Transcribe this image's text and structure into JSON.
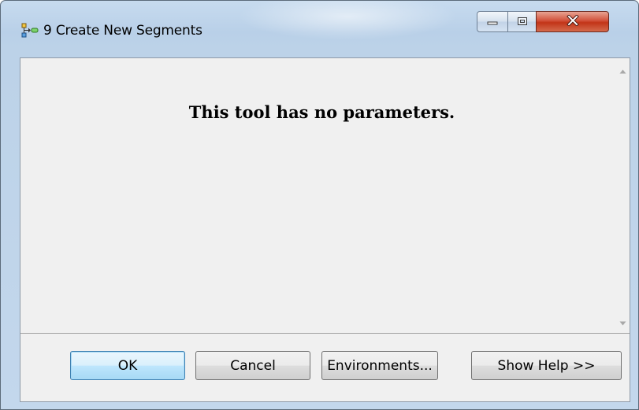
{
  "window": {
    "title": "9 Create New Segments",
    "icon": "model-tool-icon",
    "controls": {
      "minimize": "minimize-icon",
      "maximize": "maximize-icon",
      "close": "close-icon"
    }
  },
  "panel": {
    "message": "This tool has no parameters."
  },
  "buttons": {
    "ok": "OK",
    "cancel": "Cancel",
    "environments": "Environments...",
    "show_help": "Show Help >>"
  },
  "colors": {
    "title_bar": "#b9d0e8",
    "close_button": "#c23418",
    "client_background": "#f0f0f0",
    "default_button_border": "#3c7fb1"
  }
}
